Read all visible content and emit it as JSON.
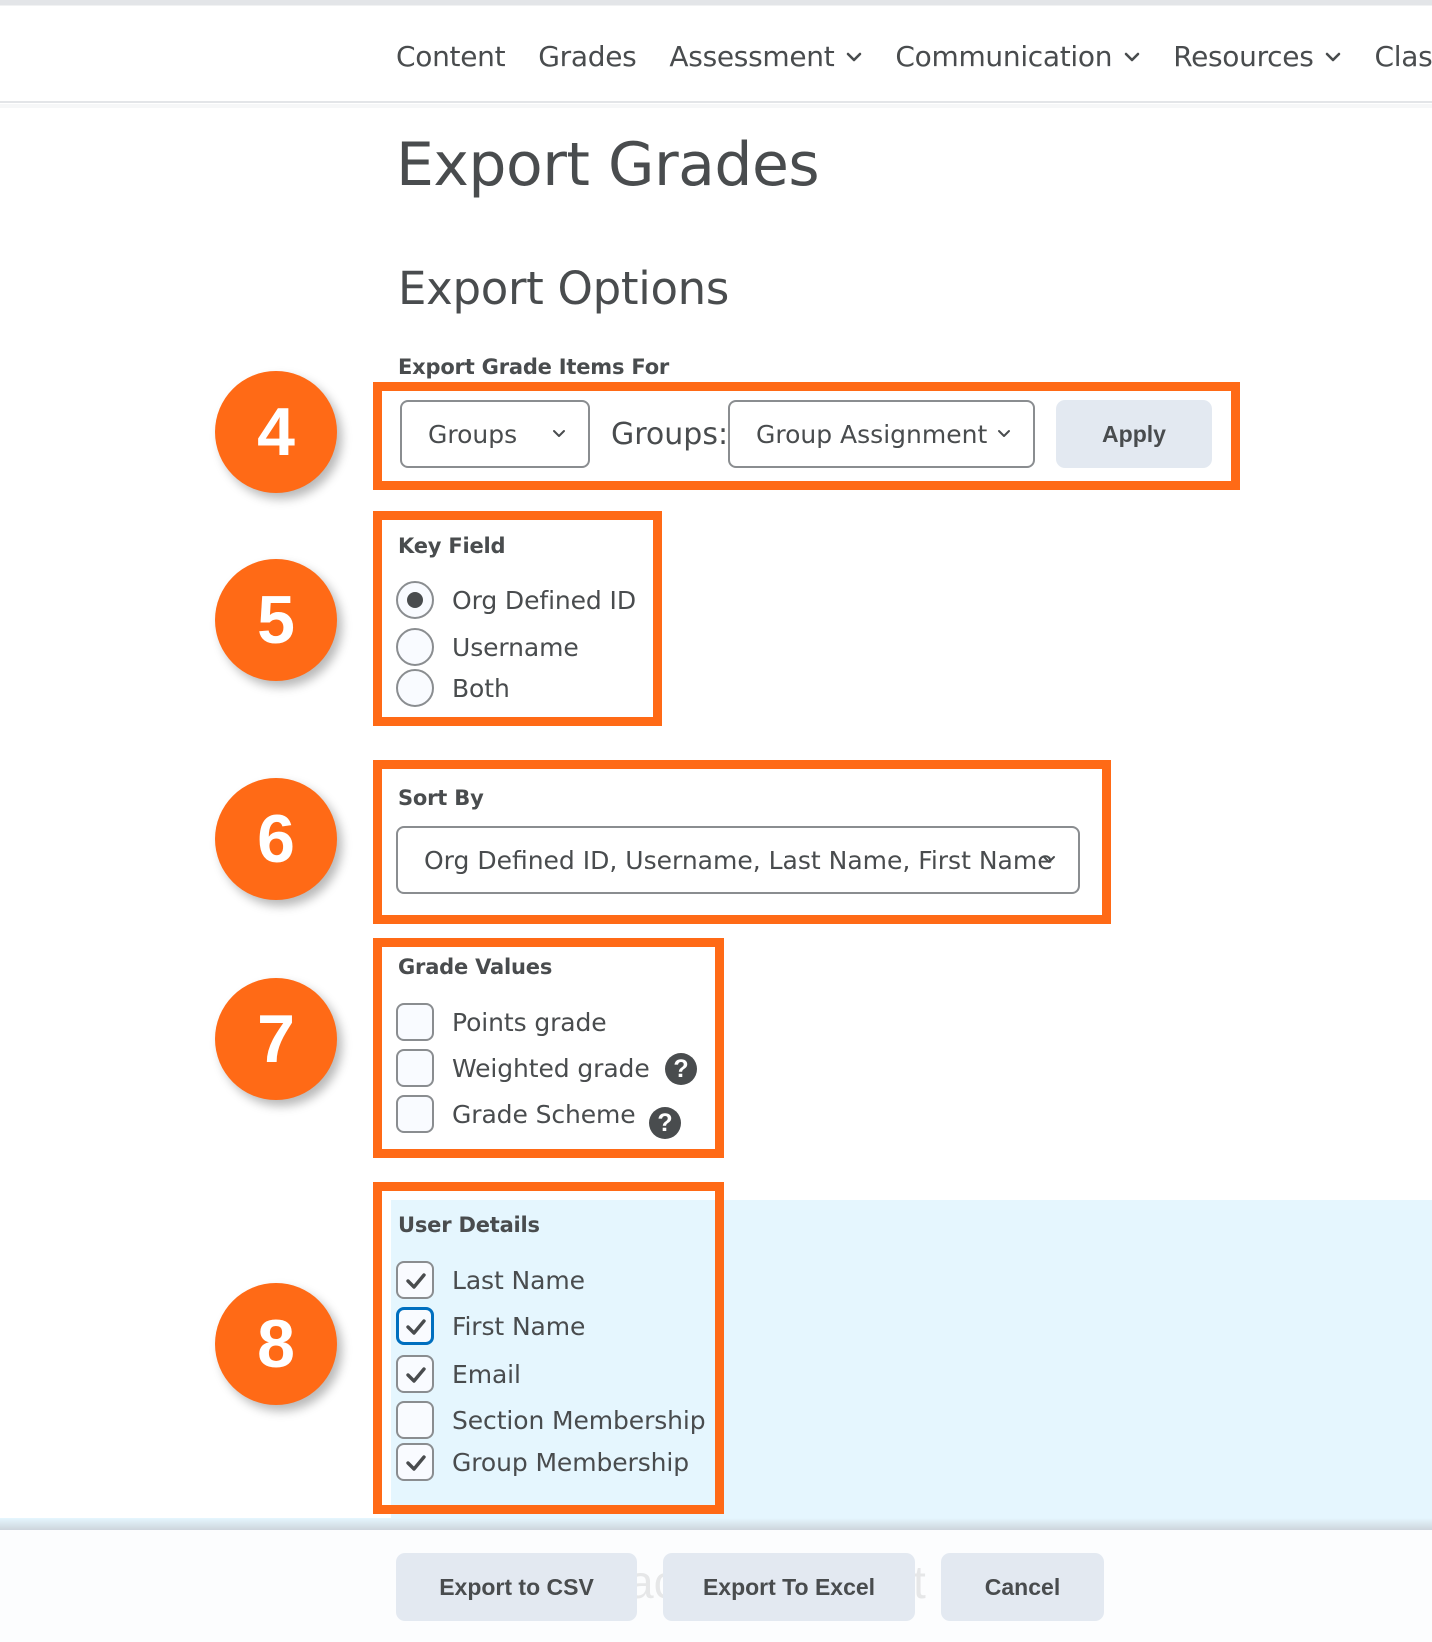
{
  "nav": {
    "items": [
      {
        "label": "Content",
        "has_menu": false
      },
      {
        "label": "Grades",
        "has_menu": false
      },
      {
        "label": "Assessment",
        "has_menu": true
      },
      {
        "label": "Communication",
        "has_menu": true
      },
      {
        "label": "Resources",
        "has_menu": true
      },
      {
        "label": "Class",
        "has_menu": false
      }
    ]
  },
  "page": {
    "title": "Export Grades",
    "section_title": "Export Options"
  },
  "annotations": {
    "badges": [
      "4",
      "5",
      "6",
      "7",
      "8"
    ],
    "highlight_color": "#ff6a16"
  },
  "export_for": {
    "label": "Export Grade Items For",
    "scope_select": {
      "value": "Groups",
      "icon": "chevron-down-icon"
    },
    "groups_label": "Groups:",
    "group_select": {
      "value": "Group Assignment",
      "icon": "chevron-down-icon"
    },
    "apply_label": "Apply"
  },
  "key_field": {
    "label": "Key Field",
    "options": [
      {
        "label": "Org Defined ID",
        "selected": true
      },
      {
        "label": "Username",
        "selected": false
      },
      {
        "label": "Both",
        "selected": false
      }
    ]
  },
  "sort_by": {
    "label": "Sort By",
    "value": "Org Defined ID, Username, Last Name, First Name"
  },
  "grade_values": {
    "label": "Grade Values",
    "options": [
      {
        "label": "Points grade",
        "checked": false,
        "help": false
      },
      {
        "label": "Weighted grade",
        "checked": false,
        "help": true
      },
      {
        "label": "Grade Scheme",
        "checked": false,
        "help": true
      }
    ],
    "help_glyph": "?"
  },
  "user_details": {
    "label": "User Details",
    "options": [
      {
        "label": "Last Name",
        "checked": true,
        "focused": false
      },
      {
        "label": "First Name",
        "checked": true,
        "focused": true
      },
      {
        "label": "Email",
        "checked": true,
        "focused": false
      },
      {
        "label": "Section Membership",
        "checked": false,
        "focused": false
      },
      {
        "label": "Group Membership",
        "checked": true,
        "focused": false
      }
    ]
  },
  "footer": {
    "export_csv_label": "Export to CSV",
    "export_excel_label": "Export To Excel",
    "cancel_label": "Cancel",
    "ghost_text_left": "ac",
    "ghost_text_right": "t"
  },
  "colors": {
    "accent_orange": "#ff6a16",
    "focus_blue": "#006fbf",
    "panel_blue": "#e5f6fe",
    "button_bg": "#e3e9f1",
    "text": "#494c4e"
  }
}
